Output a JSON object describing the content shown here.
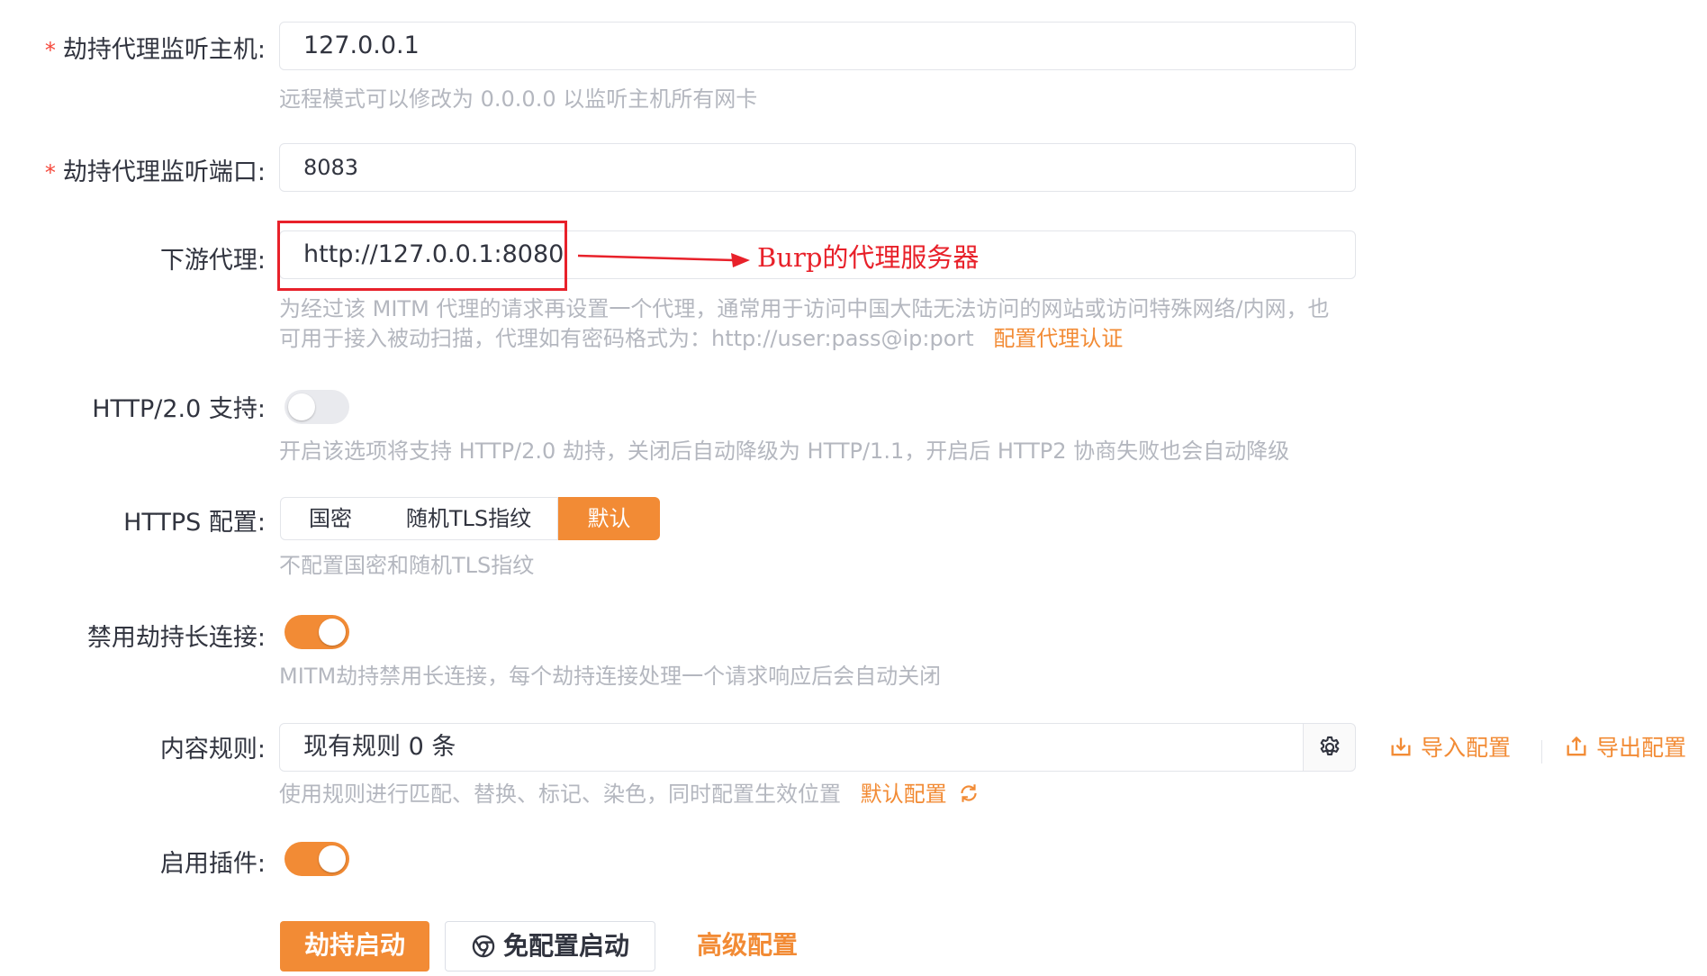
{
  "fields": {
    "host": {
      "label": "劫持代理监听主机:",
      "required_mark": "*",
      "value": "127.0.0.1",
      "help": "远程模式可以修改为 0.0.0.0 以监听主机所有网卡"
    },
    "port": {
      "label": "劫持代理监听端口:",
      "required_mark": "*",
      "value": "8083"
    },
    "downstream": {
      "label": "下游代理:",
      "value": "http://127.0.0.1:8080",
      "help_line1": "为经过该 MITM 代理的请求再设置一个代理，通常用于访问中国大陆无法访问的网站或访问特殊网络/内网，也",
      "help_line2": "可用于接入被动扫描，代理如有密码格式为：http://user:pass@ip:port",
      "auth_link": "配置代理认证"
    },
    "http2": {
      "label": "HTTP/2.0 支持:",
      "enabled": false,
      "help": "开启该选项将支持 HTTP/2.0 劫持，关闭后自动降级为 HTTP/1.1，开启后 HTTP2 协商失败也会自动降级"
    },
    "https": {
      "label": "HTTPS 配置:",
      "options": [
        "国密",
        "随机TLS指纹",
        "默认"
      ],
      "selected": "默认",
      "help": "不配置国密和随机TLS指纹"
    },
    "keepalive": {
      "label": "禁用劫持长连接:",
      "enabled": true,
      "help": "MITM劫持禁用长连接，每个劫持连接处理一个请求响应后会自动关闭"
    },
    "rules": {
      "label": "内容规则:",
      "value": "现有规则 0 条",
      "import_label": "导入配置",
      "export_label": "导出配置",
      "help": "使用规则进行匹配、替换、标记、染色，同时配置生效位置",
      "default_link": "默认配置"
    },
    "plugins": {
      "label": "启用插件:",
      "enabled": true
    }
  },
  "actions": {
    "start": "劫持启动",
    "no_config_start": "免配置启动",
    "advanced": "高级配置"
  },
  "annotation": {
    "text": "Burp的代理服务器",
    "color": "#e8212a"
  },
  "colors": {
    "accent": "#f28b35",
    "required": "#f5483b",
    "help_text": "#b4b7bf",
    "border": "#e3e5ea"
  }
}
